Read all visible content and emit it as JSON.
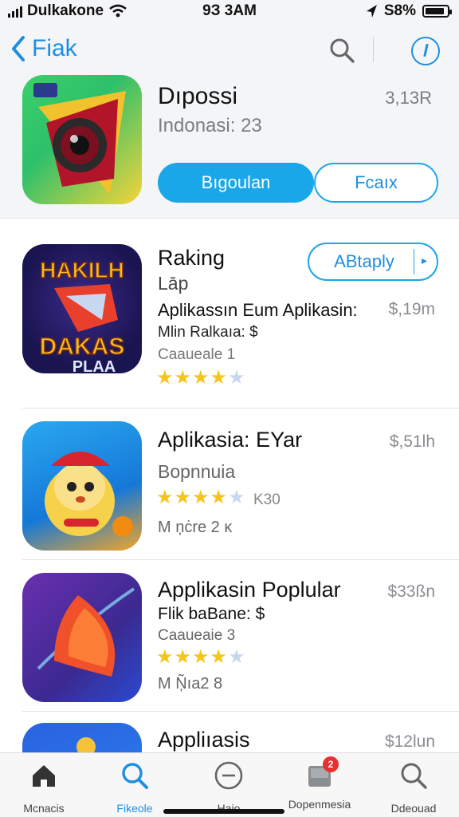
{
  "status": {
    "carrier": "Dulkakone",
    "time": "9З 3ΑΜ",
    "battery": "S8%",
    "battery_level": 0.88
  },
  "nav": {
    "back_label": "Fiak"
  },
  "featured": {
    "title": "Dıpossi",
    "subtitle": "Indonasi: 23",
    "size": "3,13R",
    "primary_button": "Bıgoulan",
    "secondary_button": "Fcaıx"
  },
  "apps": [
    {
      "title": "Raking",
      "line1": "Lāp",
      "line2": "Aplikassın Eum Aplikasin:",
      "line3": "Mlin Ralkaıa: $",
      "line4": "Caaueale 1",
      "price": "$,19m",
      "rating": 4,
      "action": "ABtaply",
      "icon_text_top": "HAKILH",
      "icon_text_mid": "DAKAS",
      "icon_text_bot": "PLAA"
    },
    {
      "title": "Aplikasia: EYar",
      "line1": "Bopnnuia",
      "rating_text": "K30",
      "line2": "M ņċre 2  ĸ",
      "price": "$,51lh",
      "rating": 4
    },
    {
      "title": "Applikasin Poplular",
      "line1": "Flik baBane: $",
      "line2": "Caaueaie 3",
      "line3": "M Ņ̃ıa2  8",
      "price": "$33ßn",
      "rating": 4
    },
    {
      "title": "Appliıasis",
      "price": "$12lun"
    }
  ],
  "tabs": [
    {
      "label": "Mcnacis",
      "icon": "home-icon"
    },
    {
      "label": "Fikeole",
      "icon": "search-icon"
    },
    {
      "label": "Haio",
      "icon": "minus-circle-icon"
    },
    {
      "label": "Dopenmesia",
      "icon": "inbox-icon",
      "badge": "2"
    },
    {
      "label": "Ddeouad",
      "icon": "search-icon"
    }
  ],
  "colors": {
    "accent": "#1aa7ea",
    "star": "#f5c518",
    "badge": "#e8312f"
  }
}
